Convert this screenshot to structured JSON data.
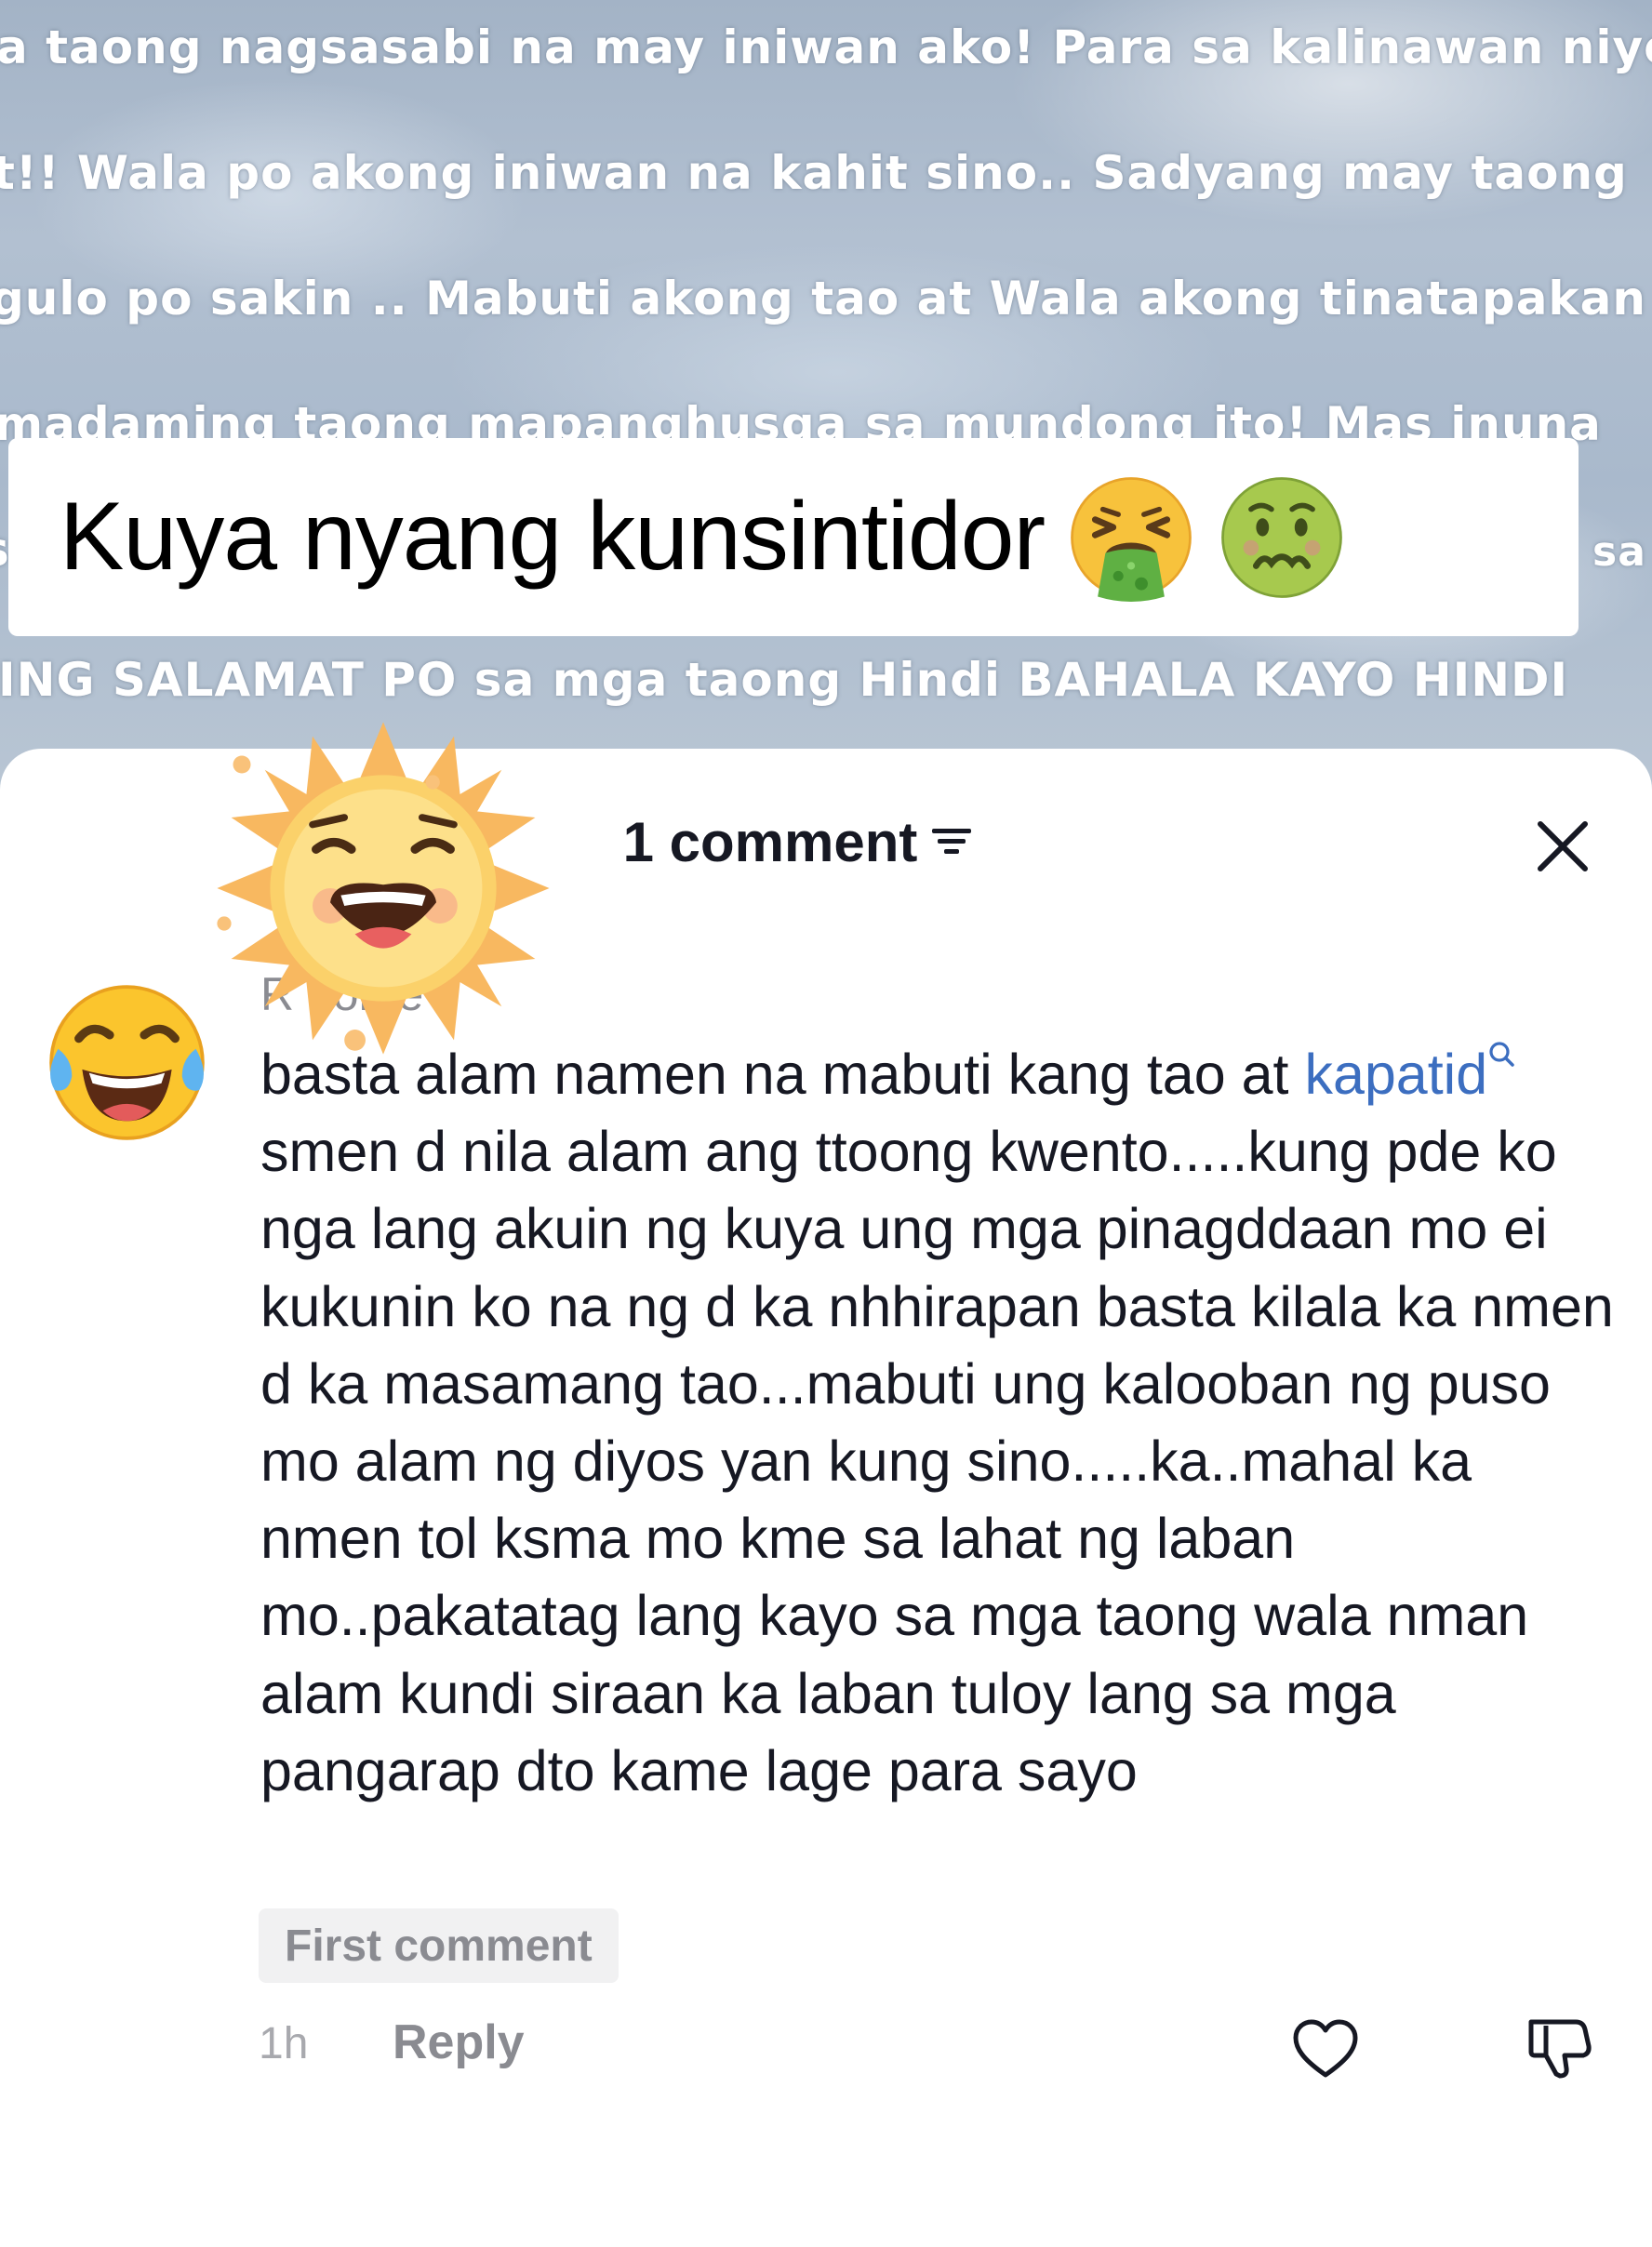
{
  "background_text": {
    "line1": "a taong nagsasabi na may iniwan ako! Para sa kalinawan niyo",
    "line2": "t!! Wala po akong iniwan na kahit sino.. Sadyang may taong",
    "line3": "gulo po sakin .. Mabuti akong tao at Wala akong tinatapakan",
    "line4": "madaming taong mapanghusga sa mundong ito! Mas inuna",
    "line5_left": "s",
    "line5_right": "sa",
    "line6": "ING SALAMAT PO sa mga taong Hindi BAHALA KAYO HINDI"
  },
  "title": {
    "text": "Kuya nyang kunsintidor",
    "emoji1": "vomiting-face-emoji",
    "emoji2": "nauseated-face-emoji"
  },
  "header": {
    "comment_count": "1 comment",
    "filter_icon": "filter-icon",
    "close_icon": "close-icon"
  },
  "comment": {
    "avatar": "face-with-tears-of-joy-emoji",
    "sticker": "laughing-sun-sticker",
    "username": "R              nonte",
    "text_before": "basta alam namen na mabuti kang tao at ",
    "mention": "kapatid",
    "text_after": " smen d nila alam ang ttoong kwento.....kung pde ko nga lang akuin ng kuya ung mga pinagddaan mo ei kukunin ko na ng d ka nhhirapan basta kilala ka nmen d ka masamang tao...mabuti ung kalooban ng puso mo alam ng diyos yan kung sino.....ka..mahal ka nmen tol ksma mo kme sa lahat ng laban mo..pakatatag lang kayo sa mga taong wala nman alam kundi siraan ka laban tuloy lang sa mga pangarap dto kame lage para sayo",
    "badge": "First comment",
    "time": "1h",
    "reply_label": "Reply",
    "like_icon": "heart-icon",
    "dislike_icon": "thumbs-down-icon"
  },
  "colors": {
    "mention": "#3c6ec0",
    "muted": "#8a8b91",
    "text": "#161823",
    "badge_bg": "#f1f1f2"
  }
}
